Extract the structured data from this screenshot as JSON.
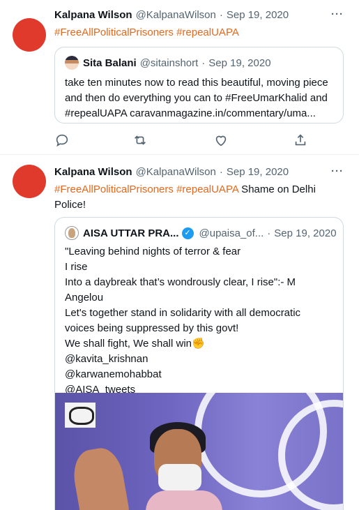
{
  "tweets": [
    {
      "name": "Kalpana Wilson",
      "handle": "@KalpanaWilson",
      "date": "Sep 19, 2020",
      "more": "···",
      "hashtags": "#FreeAllPoliticalPrisoners #repealUAPA",
      "quote": {
        "name": "Sita Balani",
        "handle": "@sitainshort",
        "date": "Sep 19, 2020",
        "line1": "take ten minutes now to read this beautiful, moving piece",
        "line2": "and then do everything you can to #FreeUmarKhalid and",
        "line3": "#repealUAPA caravanmagazine.in/commentary/uma..."
      }
    },
    {
      "name": "Kalpana Wilson",
      "handle": "@KalpanaWilson",
      "date": "Sep 19, 2020",
      "more": "···",
      "hashtags": "#FreeAllPoliticalPrisoners #repealUAPA",
      "text_after": " Shame on Delhi",
      "text_line2": "Police!",
      "quote": {
        "name": "AISA UTTAR PRA...",
        "handle": "@upaisa_of...",
        "date": "Sep 19, 2020",
        "lines": [
          "\"Leaving behind nights of terror & fear",
          "I rise",
          "Into a daybreak that’s wondrously clear, I rise\":- M",
          "Angelou",
          "Let's together stand in solidarity with all democratic",
          "voices being suppressed by this govt!",
          "We shall fight, We shall win✊",
          "@kavita_krishnan",
          "@karwanemohabbat",
          "@AISA_tweets"
        ]
      }
    }
  ],
  "colors": {
    "hashtag": "#e8671a",
    "avatar": "#e03a2c",
    "secondary": "#536471"
  },
  "icons": [
    "reply-icon",
    "retweet-icon",
    "like-icon",
    "share-icon",
    "verified-icon",
    "more-icon"
  ]
}
